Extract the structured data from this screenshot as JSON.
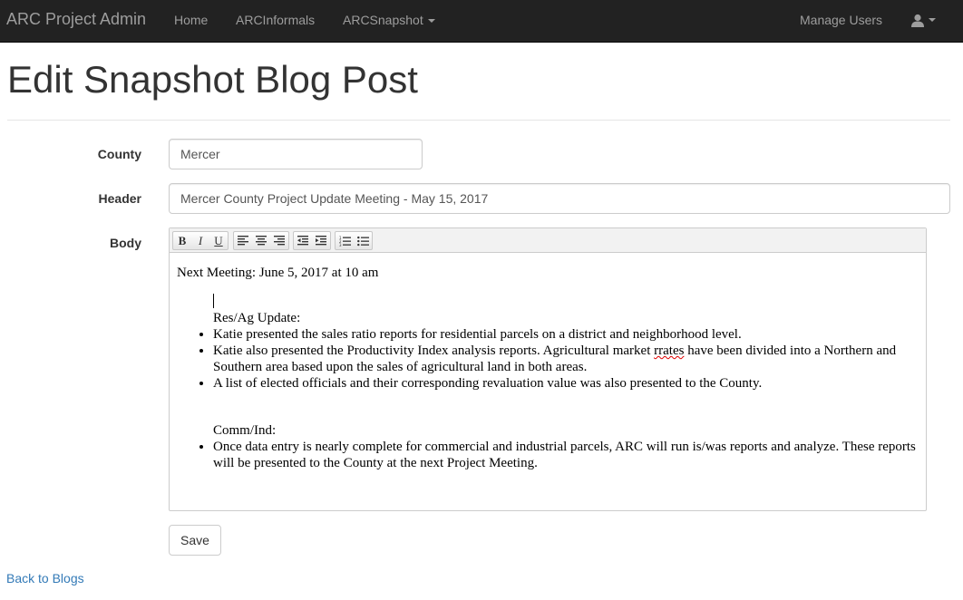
{
  "navbar": {
    "brand": "ARC Project Admin",
    "items": [
      {
        "label": "Home"
      },
      {
        "label": "ARCInformals"
      },
      {
        "label": "ARCSnapshot"
      }
    ],
    "manage_users": "Manage Users",
    "user_icon": "user-icon",
    "bg_color": "#222222",
    "text_color": "#9d9d9d"
  },
  "page": {
    "title": "Edit Snapshot Blog Post"
  },
  "form": {
    "county": {
      "label": "County",
      "value": "Mercer"
    },
    "header": {
      "label": "Header",
      "value": "Mercer County Project Update Meeting - May 15, 2017"
    },
    "body": {
      "label": "Body",
      "toolbar": [
        "bold-icon",
        "italic-icon",
        "underline-icon",
        "align-left-icon",
        "align-center-icon",
        "align-right-icon",
        "outdent-icon",
        "indent-icon",
        "ordered-list-icon",
        "unordered-list-icon"
      ],
      "toolbar_letters": {
        "bold": "B",
        "italic": "I",
        "underline": "U"
      },
      "next_meeting": "Next Meeting: June 5, 2017 at 10 am",
      "res_ag_heading": "Res/Ag Update:",
      "res_ag_items": [
        "Katie presented the sales ratio reports for residential parcels on a district and neighborhood level.",
        "A list of elected officials and their corresponding revaluation value was also presented to the County."
      ],
      "res_ag_item2_pre": "Katie also presented the Productivity Index analysis reports. Agricultural market ",
      "res_ag_item2_misspelled": "rrates",
      "res_ag_item2_post": " have been divided into a Northern and Southern area based upon the sales of agricultural land in both areas.",
      "comm_ind_heading": "Comm/Ind:",
      "comm_ind_items": [
        "Once data entry is nearly complete for commercial and industrial parcels, ARC will run is/was reports and analyze. These reports will be presented to the County at the next Project Meeting."
      ]
    },
    "save_label": "Save"
  },
  "footer": {
    "back_link": "Back to Blogs",
    "link_color": "#337ab7"
  }
}
